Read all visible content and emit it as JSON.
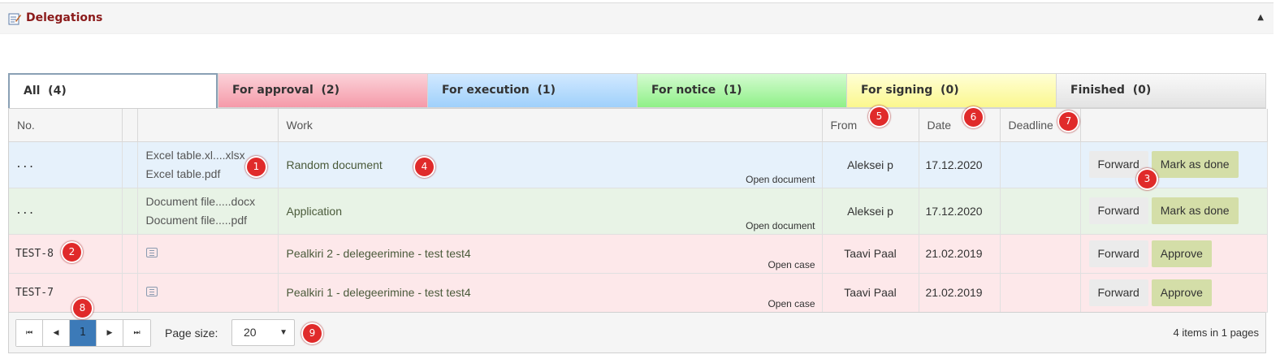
{
  "panel": {
    "title": "Delegations",
    "collapse_glyph": "▲"
  },
  "tabs": [
    {
      "label": "All  (4)"
    },
    {
      "label": "For approval  (2)"
    },
    {
      "label": "For execution  (1)"
    },
    {
      "label": "For notice  (1)"
    },
    {
      "label": "For signing  (0)"
    },
    {
      "label": "Finished  (0)"
    }
  ],
  "columns": {
    "no": "No.",
    "work": "Work",
    "from": "From",
    "date": "Date",
    "deadline": "Deadline"
  },
  "rows": [
    {
      "no": "...",
      "files": [
        "Excel table.xl....xlsx",
        "Excel table.pdf"
      ],
      "work": "Random document",
      "link": "Open document",
      "from": "Aleksei p",
      "date": "17.12.2020",
      "forward": "Forward",
      "action": "Mark as done"
    },
    {
      "no": "...",
      "files": [
        "Document file.....docx",
        "Document file.....pdf"
      ],
      "work": "Application",
      "link": "Open document",
      "from": "Aleksei p",
      "date": "17.12.2020",
      "forward": "Forward",
      "action": "Mark as done"
    },
    {
      "no": "TEST-8",
      "work": "Pealkiri 2 - delegeerimine - test test4",
      "link": "Open case",
      "from": "Taavi Paal",
      "date": "21.02.2019",
      "forward": "Forward",
      "action": "Approve"
    },
    {
      "no": "TEST-7",
      "work": "Pealkiri 1 - delegeerimine - test test4",
      "link": "Open case",
      "from": "Taavi Paal",
      "date": "21.02.2019",
      "forward": "Forward",
      "action": "Approve"
    }
  ],
  "pager": {
    "first": "⏮",
    "prev": "◀",
    "page": "1",
    "next": "▶",
    "last": "⏭",
    "page_size_label": "Page size:",
    "page_size_value": "20",
    "info": "4 items in 1 pages"
  },
  "markers": [
    "1",
    "2",
    "3",
    "4",
    "5",
    "6",
    "7",
    "8",
    "9"
  ]
}
